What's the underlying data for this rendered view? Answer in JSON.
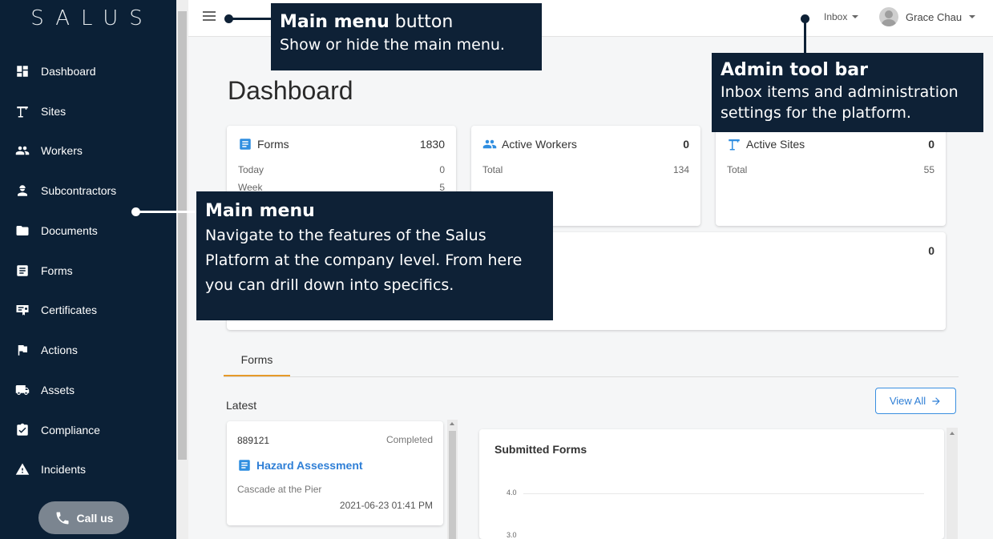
{
  "brand": {
    "logo": "SALUS"
  },
  "sidebar": {
    "items": [
      {
        "label": "Dashboard",
        "icon": "dashboard-icon"
      },
      {
        "label": "Sites",
        "icon": "crane-icon"
      },
      {
        "label": "Workers",
        "icon": "people-icon"
      },
      {
        "label": "Subcontractors",
        "icon": "worker-icon"
      },
      {
        "label": "Documents",
        "icon": "folder-icon"
      },
      {
        "label": "Forms",
        "icon": "form-icon"
      },
      {
        "label": "Certificates",
        "icon": "certificate-icon"
      },
      {
        "label": "Actions",
        "icon": "flag-icon"
      },
      {
        "label": "Assets",
        "icon": "truck-icon"
      },
      {
        "label": "Compliance",
        "icon": "clipboard-check-icon"
      },
      {
        "label": "Incidents",
        "icon": "warning-icon"
      }
    ],
    "call_us": "Call us"
  },
  "topbar": {
    "inbox_label": "Inbox",
    "user_name": "Grace Chau"
  },
  "dashboard": {
    "title": "Dashboard",
    "cards": {
      "forms": {
        "title": "Forms",
        "count": "1830",
        "rows": [
          {
            "label": "Today",
            "value": "0"
          },
          {
            "label": "Week",
            "value": "5"
          }
        ]
      },
      "active_workers": {
        "title": "Active Workers",
        "count": "0",
        "rows": [
          {
            "label": "Total",
            "value": "134"
          }
        ]
      },
      "active_sites": {
        "title": "Active Sites",
        "count": "0",
        "rows": [
          {
            "label": "Total",
            "value": "55"
          }
        ]
      },
      "wide_card_count": "0"
    },
    "tabs": [
      {
        "label": "Forms"
      }
    ],
    "latest_label": "Latest",
    "view_all": "View All",
    "latest_form": {
      "id": "889121",
      "status": "Completed",
      "title": "Hazard Assessment",
      "site": "Cascade at the Pier",
      "date": "2021-06-23 01:41 PM"
    },
    "chart": {
      "title": "Submitted Forms",
      "y_ticks": [
        "4.0",
        "3.0"
      ]
    }
  },
  "callouts": {
    "main_menu_button": {
      "heading": "Main menu",
      "heading_rest": " button",
      "body": "Show or hide the main menu."
    },
    "admin_toolbar": {
      "heading": "Admin tool bar",
      "body_line1": "Inbox items and administration",
      "body_line2": "settings for the platform."
    },
    "main_menu": {
      "heading": "Main menu",
      "body_line1": "Navigate to the features of the Salus",
      "body_line2": "Platform at the company level. From here",
      "body_line3": "you can drill down into specifics."
    }
  },
  "colors": {
    "sidebar_bg": "#0b2036",
    "callout_bg": "#0e2136",
    "accent_blue": "#2f8ee0",
    "tab_underline": "#e69a2a"
  }
}
